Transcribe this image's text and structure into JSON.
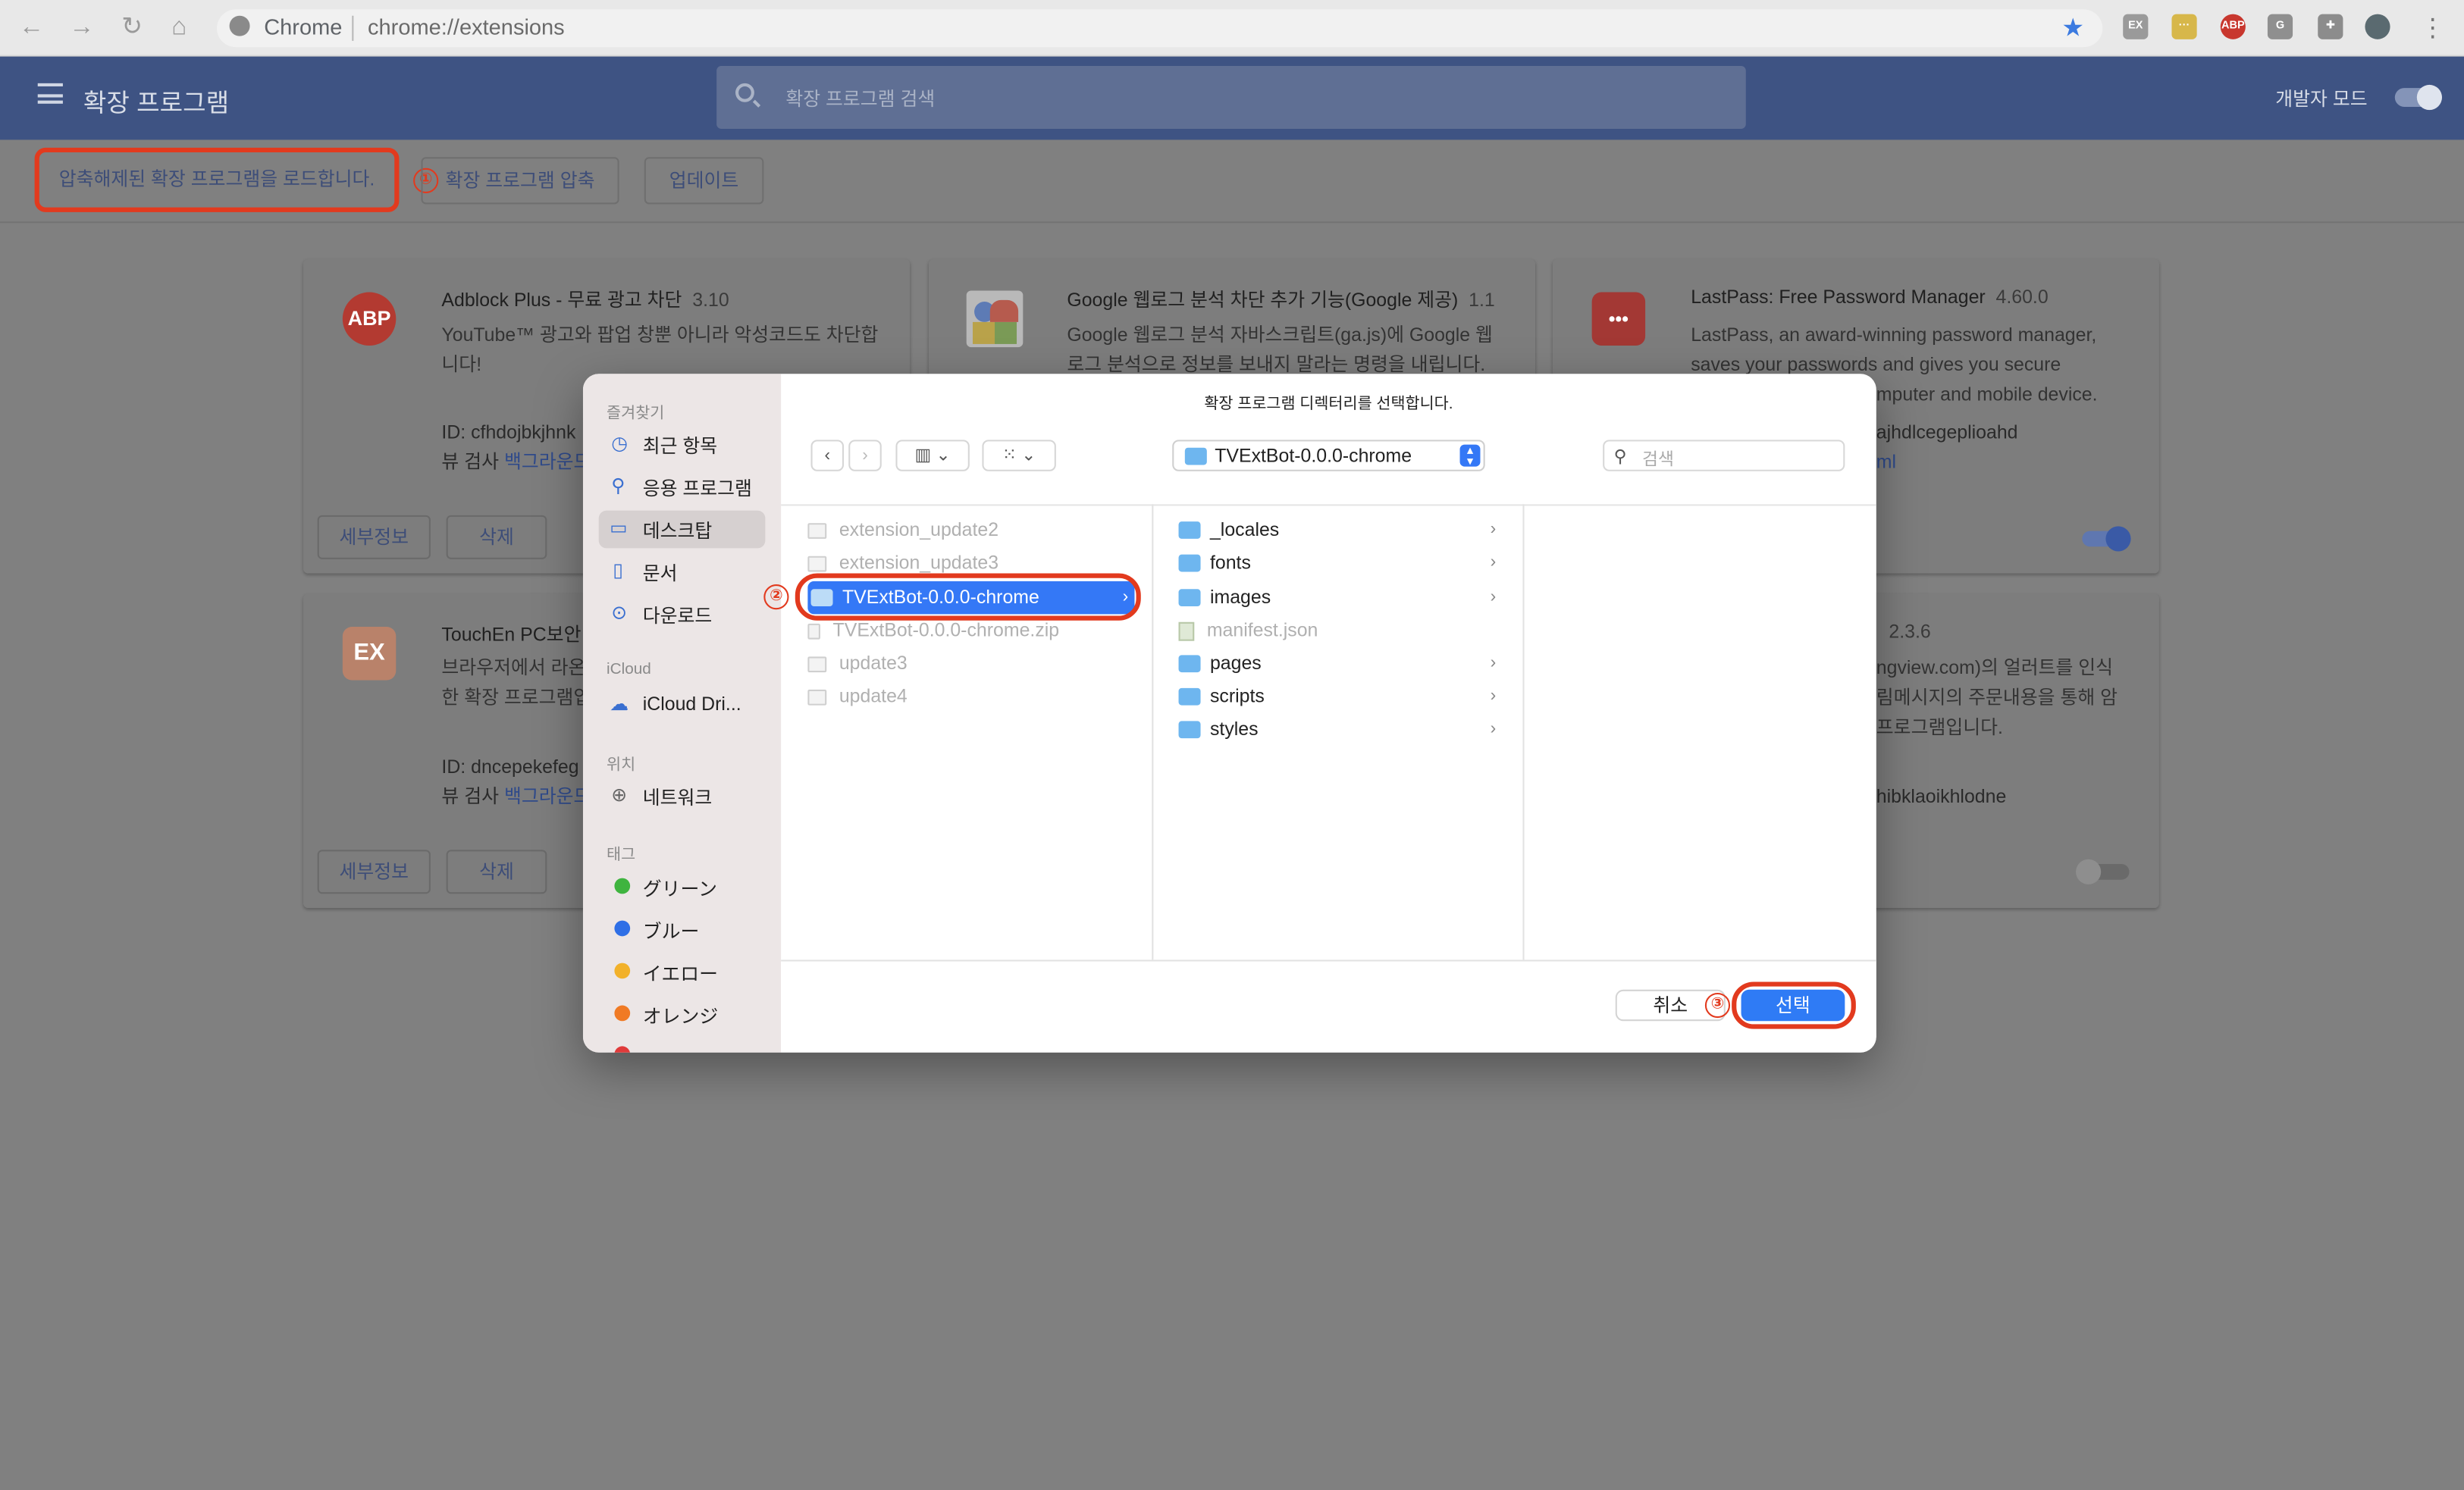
{
  "browser": {
    "site_label": "Chrome",
    "url": "chrome://extensions",
    "toolbar_extensions": [
      "EX",
      "LastPass",
      "ABP",
      "puzzle"
    ]
  },
  "header": {
    "title": "확장 프로그램",
    "search_placeholder": "확장 프로그램 검색",
    "dev_mode_label": "개발자 모드"
  },
  "actions": {
    "load_unpacked": "압축해제된 확장 프로그램을 로드합니다.",
    "pack": "확장 프로그램 압축",
    "update": "업데이트"
  },
  "annotations": {
    "step1": "①",
    "step2": "②",
    "step3": "③",
    "color": "#e23a1e"
  },
  "cards": {
    "adblock": {
      "icon": "ABP",
      "title": "Adblock Plus - 무료 광고 차단",
      "version": "3.10",
      "desc1": "YouTube™ 광고와 팝업 창뿐 아니라 악성코드도 차단합",
      "desc2": "니다!",
      "id": "ID: cfhdojbkjhnk",
      "view_prefix": "뷰 검사",
      "view_link": "백그라운드",
      "details": "세부정보",
      "remove": "삭제"
    },
    "google": {
      "title": "Google 웹로그 분석 차단 추가 기능(Google 제공)",
      "version": "1.1",
      "desc1": "Google 웹로그 분석 자바스크립트(ga.js)에 Google 웹",
      "desc2": "로그 분석으로 정보를 보내지 말라는 명령을 내립니다."
    },
    "lastpass": {
      "icon": "•••",
      "title": "LastPass: Free Password Manager",
      "version": "4.60.0",
      "desc1": "LastPass, an award-winning password manager,",
      "desc2": "saves your passwords and gives you secure",
      "desc3": "mputer and mobile device.",
      "id_tail": "ajhdlcegeplioahd",
      "link_tail": "ml",
      "enabled": true
    },
    "touchen": {
      "icon": "EX",
      "title": "TouchEn PC보안",
      "desc1": "브라우저에서 라온",
      "desc2": "한 확장 프로그램입",
      "id": "ID: dncepekefeg",
      "view_prefix": "뷰 검사",
      "view_link": "백그라운드",
      "details": "세부정보",
      "remove": "삭제"
    },
    "fourth": {
      "version": "2.3.6",
      "desc1": "ngview.com)의 얼러트를 인식",
      "desc2": "림메시지의 주문내용을 통해 암",
      "desc3": "프로그램입니다.",
      "id_tail": "hibklaoikhlodne",
      "enabled": false
    }
  },
  "dialog": {
    "title": "확장 프로그램 디렉터리를 선택합니다.",
    "path": "TVExtBot-0.0.0-chrome",
    "search_placeholder": "검색",
    "sidebar": {
      "favorites_header": "즐겨찾기",
      "favorites": [
        {
          "label": "최근 항목",
          "icon": "clock-icon"
        },
        {
          "label": "응용 프로그램",
          "icon": "apps-icon"
        },
        {
          "label": "데스크탑",
          "icon": "desktop-icon"
        },
        {
          "label": "문서",
          "icon": "document-icon"
        },
        {
          "label": "다운로드",
          "icon": "download-icon"
        }
      ],
      "icloud_header": "iCloud",
      "icloud_drive": "iCloud Dri...",
      "location_header": "위치",
      "network": "네트워크",
      "tags_header": "태그",
      "tags": [
        {
          "label": "グリーン",
          "color": "#3fb43f"
        },
        {
          "label": "ブルー",
          "color": "#2f6fe6"
        },
        {
          "label": "イエロー",
          "color": "#f2b12a"
        },
        {
          "label": "オレンジ",
          "color": "#f07a24"
        }
      ]
    },
    "column1": [
      {
        "name": "extension_update2",
        "type": "file",
        "dim": true
      },
      {
        "name": "extension_update3",
        "type": "file",
        "dim": true
      },
      {
        "name": "TVExtBot-0.0.0-chrome",
        "type": "folder",
        "selected": true
      },
      {
        "name": "TVExtBot-0.0.0-chrome.zip",
        "type": "file",
        "dim": true
      },
      {
        "name": "update3",
        "type": "file",
        "dim": true
      },
      {
        "name": "update4",
        "type": "file",
        "dim": true
      }
    ],
    "column2": [
      {
        "name": "_locales",
        "type": "folder"
      },
      {
        "name": "fonts",
        "type": "folder"
      },
      {
        "name": "images",
        "type": "folder"
      },
      {
        "name": "manifest.json",
        "type": "json"
      },
      {
        "name": "pages",
        "type": "folder"
      },
      {
        "name": "scripts",
        "type": "folder"
      },
      {
        "name": "styles",
        "type": "folder"
      }
    ],
    "cancel": "취소",
    "select": "선택"
  }
}
